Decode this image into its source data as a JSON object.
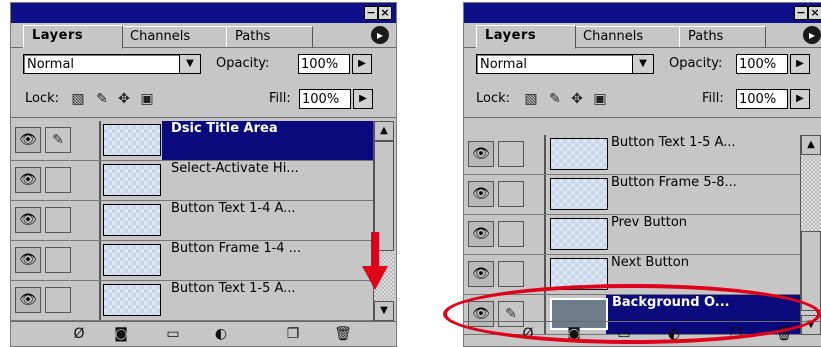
{
  "panels": [
    {
      "tabs": [
        "Layers",
        "Channels",
        "Paths"
      ],
      "blend_mode": "Normal",
      "opacity_label": "Opacity:",
      "opacity_value": "100%",
      "lock_label": "Lock:",
      "fill_label": "Fill:",
      "fill_value": "100%",
      "layers": [
        {
          "name": "Dsic Title Area",
          "selected": true
        },
        {
          "name": "Select-Activate Hi...",
          "selected": false
        },
        {
          "name": "Button Text 1-4 A...",
          "selected": false
        },
        {
          "name": "Button Frame 1-4 ...",
          "selected": false
        },
        {
          "name": "Button Text 1-5 A...",
          "selected": false
        }
      ]
    },
    {
      "tabs": [
        "Layers",
        "Channels",
        "Paths"
      ],
      "blend_mode": "Normal",
      "opacity_label": "Opacity:",
      "opacity_value": "100%",
      "lock_label": "Lock:",
      "fill_label": "Fill:",
      "fill_value": "100%",
      "layers": [
        {
          "name": "Button Text 1-5 A...",
          "selected": false
        },
        {
          "name": "Button Frame 5-8...",
          "selected": false
        },
        {
          "name": "Prev Button",
          "selected": false
        },
        {
          "name": "Next Button",
          "selected": false
        },
        {
          "name": "Background O...",
          "selected": true
        }
      ]
    }
  ],
  "colors": {
    "accent": "#0a0a7d",
    "annotation": "#e0001a",
    "panel_bg": "#c6c6c6"
  },
  "icons": [
    "eye-icon",
    "brush-icon",
    "transparency-lock-icon",
    "paint-lock-icon",
    "move-lock-icon",
    "padlock-icon",
    "menu-arrow-icon",
    "layer-style-icon",
    "mask-icon",
    "folder-icon",
    "adjustment-layer-icon",
    "new-layer-icon",
    "trash-icon",
    "red-down-arrow",
    "red-highlight-ellipse"
  ]
}
